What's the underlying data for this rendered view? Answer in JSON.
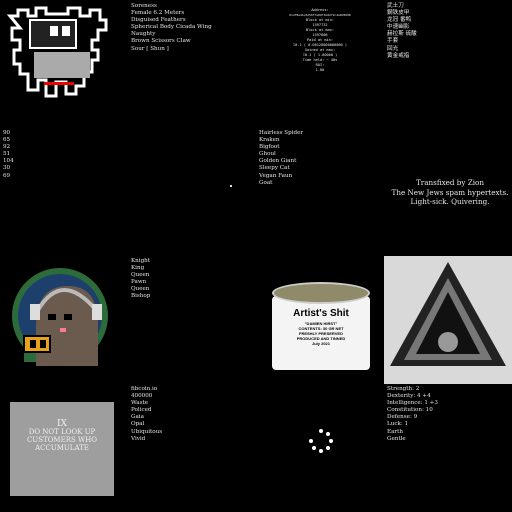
{
  "tiles": {
    "top_middle_list": [
      "Soreness",
      "Female 6.2 Meters",
      "Disguised Feathers",
      "Spherical Body Cicada Wing",
      "Naughty",
      "Brown Scissors Claw",
      "Sour [ Shun ]"
    ],
    "block_info": [
      "Address:",
      "0x4f8a4bc6d56f7a00f1b82f2c4a8d5698",
      "",
      "Block at min:",
      "1597732",
      "",
      "Block at max:",
      "1597808",
      "",
      "Paid at min:",
      "Ξ0.1 ( 0.00128000000000 )",
      "",
      "Gained at max:",
      "Ξ0.1 ( 1.00000 )",
      "",
      "Time held: ~ 40s",
      "",
      "ROI:",
      "1.00"
    ],
    "chinese_list": [
      "武士刀",
      "鋼铁皮甲",
      "龙冠 番鸭",
      "中速幽影",
      "赫拉斯 硫酸",
      "手套",
      "回光",
      "黄金戒指"
    ],
    "numbers_list": [
      "90",
      "65",
      "92",
      "51",
      "104",
      "30",
      "69"
    ],
    "creatures_list": [
      "Hairless Spider",
      "Kraken",
      "Bigfoot",
      "Ghoul",
      "Golden Giant",
      "Sleepy Cat",
      "Vegan Faun",
      "Goat"
    ],
    "poem": [
      "Transfixed by Zion",
      "The New Jews spam hypertexts.",
      "Light-sick. Quivering."
    ],
    "chess_list": [
      "Knight",
      "King",
      "Queen",
      "Pawn",
      "Queen",
      "Bishop"
    ],
    "can": {
      "title": "Artist's Shit",
      "subtitle": "\"DAMIEN HIRST\"",
      "line1": "CONTENTS: 30 GR NET",
      "line2": "FRESHLY PRESERVED",
      "line3": "PRODUCED AND TINNED",
      "line4": "July 2021"
    },
    "words_list": [
      "fibcoin.io",
      "400000",
      "Waste",
      "Policed",
      "Gaia",
      "Opal",
      "Ubiquitous",
      "Vivid"
    ],
    "stats_list": [
      "Strength: 2",
      "Dexterity: 4 +4",
      "Intelligence: 1 +3",
      "Constitution: 10",
      "Defense: 9",
      "Luck: 1",
      "Earth",
      "Gentle"
    ],
    "plaque": {
      "numeral": "IX",
      "line1": "DO NOT LOOK UP",
      "line2": "CUSTOMERS WHO",
      "line3": "ACCUMULATE"
    },
    "colors": {
      "bg": "#000000",
      "text": "#e6e6e6",
      "avatar_ring": "#2e6b3a",
      "badge": "#e8a21a"
    }
  }
}
